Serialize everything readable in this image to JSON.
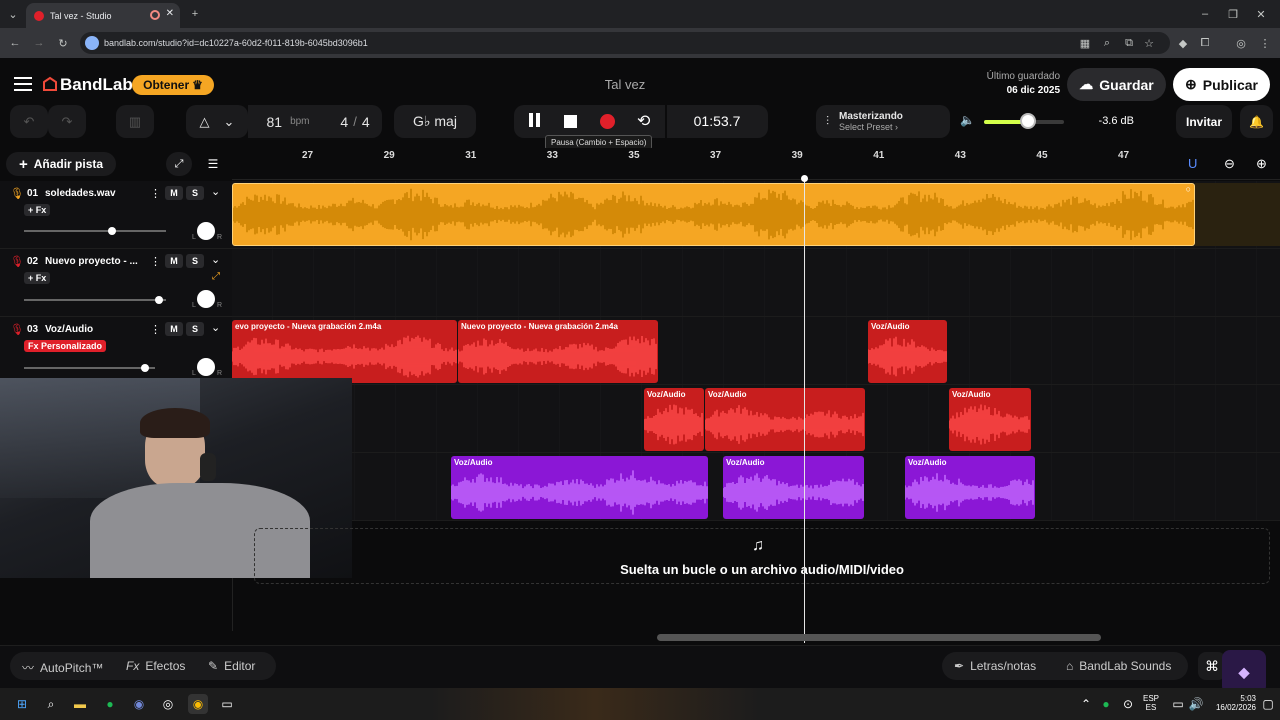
{
  "browser": {
    "tab_title": "Tal vez - Studio",
    "new_tab_glyph": "+",
    "url": "bandlab.com/studio?id=dc10227a-60d2-f011-819b-6045bd3096b1"
  },
  "header": {
    "brand": "BandLab",
    "obtener_label": "Obtener",
    "project_title": "Tal vez",
    "last_saved_label": "Último guardado",
    "last_saved_date": "06 dic 2025",
    "save_label": "Guardar",
    "publish_label": "Publicar"
  },
  "toolbar": {
    "bpm_value": "81",
    "bpm_unit": "bpm",
    "time_sig_num": "4",
    "time_sig_sep": "/",
    "time_sig_den": "4",
    "key": "G♭ maj",
    "time_display": "01:53.7",
    "pause_tooltip": "Pausa (Cambio + Espacio)",
    "mastering_label": "Masterizando",
    "mastering_preset": "Select Preset ›",
    "volume_db": "-3.6 dB",
    "invite_label": "Invitar"
  },
  "tracks_panel": {
    "add_track_label": "Añadir pista",
    "tracks": [
      {
        "num": "01",
        "name": "soledades.wav",
        "fx": "+ Fx",
        "m": "M",
        "s": "S",
        "l": "L",
        "r": "R",
        "volume": 0.62
      },
      {
        "num": "02",
        "name": "Nuevo proyecto - ...",
        "fx": "+ Fx",
        "m": "M",
        "s": "S",
        "l": "L",
        "r": "R",
        "volume": 0.95
      },
      {
        "num": "03",
        "name": "Voz/Audio",
        "fx": "Fx Personalizado",
        "m": "M",
        "s": "S",
        "l": "L",
        "r": "R",
        "volume": 0.92
      }
    ]
  },
  "ruler": [
    "27",
    "29",
    "31",
    "33",
    "35",
    "37",
    "39",
    "41",
    "43",
    "45",
    "47"
  ],
  "clips": {
    "c1": "evo proyecto - Nueva grabación 2.m4a",
    "c2": "Nuevo proyecto - Nueva grabación 2.m4a",
    "c3": "Voz/Audio",
    "c4": "Voz/Audio",
    "c5": "Voz/Audio",
    "c6": "Voz/Audio",
    "c7": "Voz/Audio",
    "c8": "Voz/Audio",
    "c9": "Voz/Audio"
  },
  "drop_zone": "Suelta un bucle o un archivo audio/MIDI/video",
  "bottom_bar": {
    "autopitch": "AutoPitch™",
    "effects": "Efectos",
    "editor": "Editor",
    "lyrics": "Letras/notas",
    "sounds": "BandLab Sounds"
  },
  "taskbar": {
    "lang1": "ESP",
    "lang2": "ES",
    "time": "5:03",
    "date": "16/02/2026"
  },
  "colors": {
    "accent_yellow": "#f5a623",
    "record_red": "#e0202a",
    "clip_red": "#c81e1e",
    "clip_purple": "#8b17d6",
    "brand_orange": "#f5a623"
  }
}
